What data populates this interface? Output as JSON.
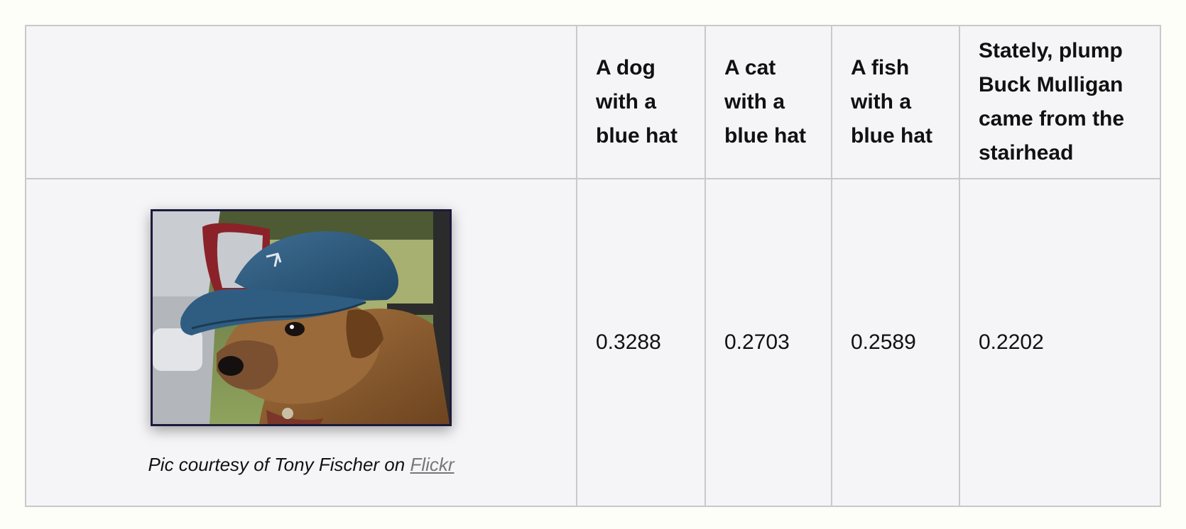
{
  "table": {
    "headers": [
      "A dog with a blue hat",
      "A cat with a blue hat",
      "A fish with a blue hat",
      "Stately, plump Buck Mulligan came from the stairhead"
    ],
    "scores": [
      "0.3288",
      "0.2703",
      "0.2589",
      "0.2202"
    ]
  },
  "image": {
    "subject": "dog-wearing-blue-cap-photo",
    "caption_prefix": "Pic courtesy of Tony Fischer on ",
    "caption_link": "Flickr"
  }
}
